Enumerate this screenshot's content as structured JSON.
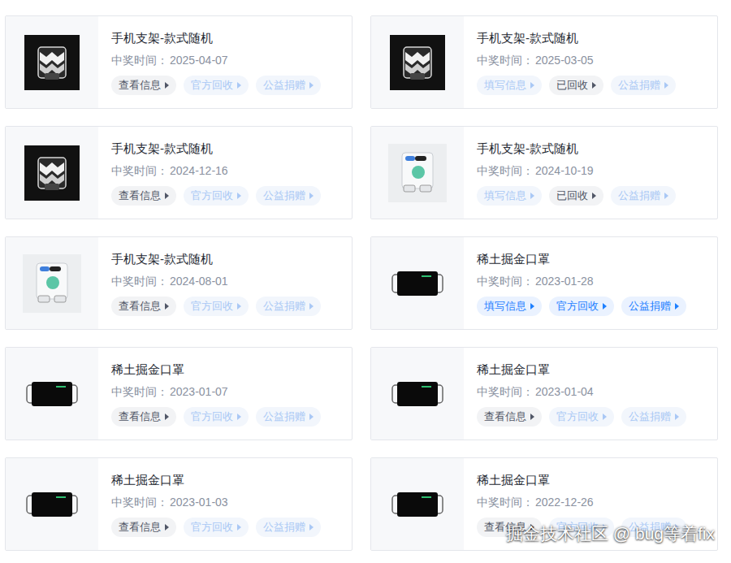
{
  "date_label": "中奖时间：",
  "cards": [
    {
      "title": "手机支架-款式随机",
      "date": "2025-04-07",
      "kind": "black-stand",
      "buttons": [
        {
          "label": "查看信息",
          "state": "normal"
        },
        {
          "label": "官方回收",
          "state": "disabled"
        },
        {
          "label": "公益捐赠",
          "state": "disabled"
        }
      ]
    },
    {
      "title": "手机支架-款式随机",
      "date": "2025-03-05",
      "kind": "black-stand",
      "buttons": [
        {
          "label": "填写信息",
          "state": "disabled"
        },
        {
          "label": "已回收",
          "state": "normal"
        },
        {
          "label": "公益捐赠",
          "state": "disabled"
        }
      ]
    },
    {
      "title": "手机支架-款式随机",
      "date": "2024-12-16",
      "kind": "black-stand",
      "buttons": [
        {
          "label": "查看信息",
          "state": "normal"
        },
        {
          "label": "官方回收",
          "state": "disabled"
        },
        {
          "label": "公益捐赠",
          "state": "disabled"
        }
      ]
    },
    {
      "title": "手机支架-款式随机",
      "date": "2024-10-19",
      "kind": "clear-stand",
      "buttons": [
        {
          "label": "填写信息",
          "state": "disabled"
        },
        {
          "label": "已回收",
          "state": "normal"
        },
        {
          "label": "公益捐赠",
          "state": "disabled"
        }
      ]
    },
    {
      "title": "手机支架-款式随机",
      "date": "2024-08-01",
      "kind": "clear-stand",
      "buttons": [
        {
          "label": "查看信息",
          "state": "normal"
        },
        {
          "label": "官方回收",
          "state": "disabled"
        },
        {
          "label": "公益捐赠",
          "state": "disabled"
        }
      ]
    },
    {
      "title": "稀土掘金口罩",
      "date": "2023-01-28",
      "kind": "mask",
      "buttons": [
        {
          "label": "填写信息",
          "state": "active"
        },
        {
          "label": "官方回收",
          "state": "active"
        },
        {
          "label": "公益捐赠",
          "state": "active"
        }
      ]
    },
    {
      "title": "稀土掘金口罩",
      "date": "2023-01-07",
      "kind": "mask",
      "buttons": [
        {
          "label": "查看信息",
          "state": "normal"
        },
        {
          "label": "官方回收",
          "state": "disabled"
        },
        {
          "label": "公益捐赠",
          "state": "disabled"
        }
      ]
    },
    {
      "title": "稀土掘金口罩",
      "date": "2023-01-04",
      "kind": "mask",
      "buttons": [
        {
          "label": "查看信息",
          "state": "normal"
        },
        {
          "label": "官方回收",
          "state": "disabled"
        },
        {
          "label": "公益捐赠",
          "state": "disabled"
        }
      ]
    },
    {
      "title": "稀土掘金口罩",
      "date": "2023-01-03",
      "kind": "mask",
      "buttons": [
        {
          "label": "查看信息",
          "state": "normal"
        },
        {
          "label": "官方回收",
          "state": "disabled"
        },
        {
          "label": "公益捐赠",
          "state": "disabled"
        }
      ]
    },
    {
      "title": "稀土掘金口罩",
      "date": "2022-12-26",
      "kind": "mask",
      "buttons": [
        {
          "label": "查看信息",
          "state": "normal"
        },
        {
          "label": "官方回收",
          "state": "disabled"
        },
        {
          "label": "公益捐赠",
          "state": "disabled"
        }
      ]
    }
  ],
  "watermark": "掘金技术社区 @ bug等着fix"
}
